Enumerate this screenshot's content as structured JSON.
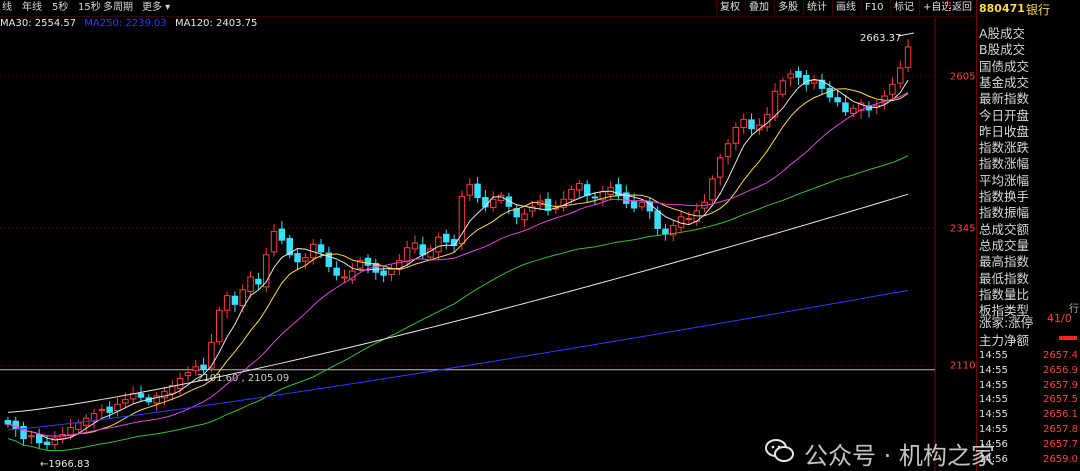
{
  "toolbar": {
    "periods": [
      "线",
      "年线",
      "5秒",
      "15秒",
      "多周期",
      "更多"
    ],
    "buttons": [
      "复权",
      "叠加",
      "多股",
      "统计",
      "画线",
      "F10",
      "标记",
      "+自选",
      "返回"
    ]
  },
  "ma_legend": [
    {
      "label": "MA30: 2554.57",
      "color": "#e8e8e8"
    },
    {
      "label": "MA250: 2239.03",
      "color": "#2b3cff"
    },
    {
      "label": "MA120: 2403.75",
      "color": "#e8e8e8"
    }
  ],
  "side_panel": {
    "code": "880471",
    "name": "银行",
    "fields": [
      "A股成交",
      "B股成交",
      "国债成交",
      "基金成交",
      "最新指数",
      "今日开盘",
      "昨日收盘",
      "指数涨跌",
      "指数涨幅",
      "平均涨幅",
      "指数换手",
      "指数振幅",
      "总成交额",
      "总成交量",
      "最高指数",
      "最低指数",
      "指数量比",
      "板指类型"
    ],
    "type_value": "行",
    "up_down_label": "涨家:涨停",
    "up_down_value": "41/0",
    "main_flow_label": "主力净额",
    "ticks": [
      {
        "time": "14:55",
        "price": "2657.4"
      },
      {
        "time": "14:55",
        "price": "2656.9"
      },
      {
        "time": "14:55",
        "price": "2657.9"
      },
      {
        "time": "14:55",
        "price": "2657.5"
      },
      {
        "time": "14:55",
        "price": "2656.1"
      },
      {
        "time": "14:55",
        "price": "2657.8"
      },
      {
        "time": "14:56",
        "price": "2657.7"
      },
      {
        "time": "14:56",
        "price": "2659.0"
      }
    ]
  },
  "annotations": {
    "high": "2663.37",
    "low": "1966.83",
    "ref_line": "2101.60 , 2105.09"
  },
  "watermark": "公众号 · 机构之家",
  "chart_data": {
    "type": "candlestick",
    "y_ticks": [
      2605,
      2345,
      2110
    ],
    "ylim": [
      1945,
      2685
    ],
    "colors": {
      "up": "#ff3c3c",
      "down": "#38e0ff",
      "ma5": "#e8e8e8",
      "ma10": "#ffd84a",
      "ma20": "#e040e0",
      "ma60": "#30c030",
      "ma120": "#e8e8e8",
      "ma250": "#2b3cff"
    },
    "closes": [
      2010,
      2002,
      1985,
      1990,
      1978,
      1975,
      1986,
      1992,
      2004,
      2012,
      2020,
      2028,
      2035,
      2030,
      2044,
      2052,
      2062,
      2056,
      2048,
      2058,
      2066,
      2076,
      2088,
      2098,
      2108,
      2104,
      2150,
      2205,
      2230,
      2215,
      2240,
      2262,
      2250,
      2300,
      2340,
      2325,
      2300,
      2288,
      2295,
      2318,
      2305,
      2280,
      2265,
      2262,
      2272,
      2290,
      2282,
      2270,
      2265,
      2275,
      2290,
      2312,
      2320,
      2300,
      2310,
      2330,
      2322,
      2316,
      2400,
      2420,
      2398,
      2382,
      2395,
      2402,
      2383,
      2365,
      2370,
      2382,
      2392,
      2376,
      2380,
      2395,
      2412,
      2422,
      2402,
      2398,
      2408,
      2415,
      2402,
      2388,
      2380,
      2390,
      2375,
      2345,
      2336,
      2350,
      2365,
      2362,
      2375,
      2390,
      2430,
      2466,
      2490,
      2518,
      2532,
      2516,
      2522,
      2540,
      2580,
      2598,
      2610,
      2604,
      2592,
      2598,
      2585,
      2570,
      2562,
      2545,
      2551,
      2560,
      2548,
      2556,
      2572,
      2592,
      2620,
      2656
    ]
  }
}
